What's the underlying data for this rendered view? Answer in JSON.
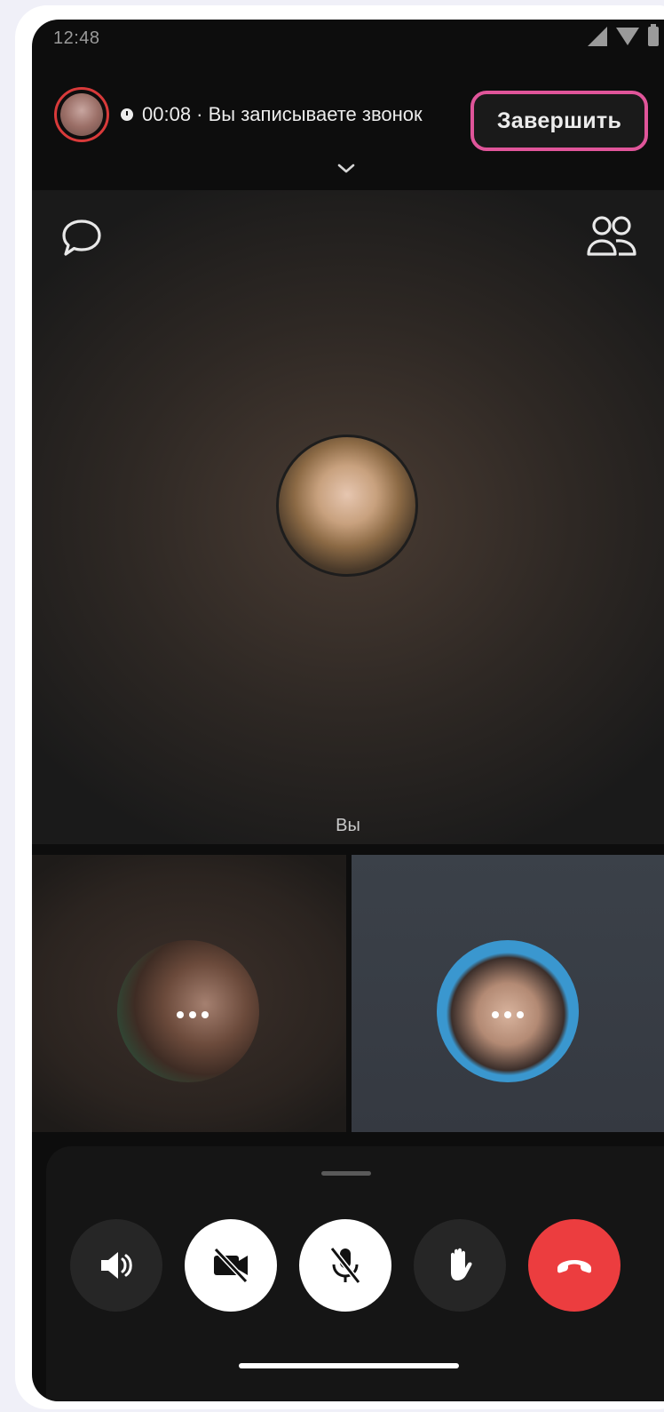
{
  "status_bar": {
    "time": "12:48"
  },
  "call_header": {
    "status_text": "00:08 · Вы записываете звонок",
    "end_button_label": "Завершить",
    "highlight_color": "#e0559a"
  },
  "main_tile": {
    "label": "Вы"
  },
  "controls": {
    "speaker": "speaker-icon",
    "camera": "camera-off-icon",
    "microphone": "mic-off-icon",
    "raise_hand": "raise-hand-icon",
    "hang_up": "hang-up-icon",
    "hang_up_color": "#ec3d3f"
  }
}
